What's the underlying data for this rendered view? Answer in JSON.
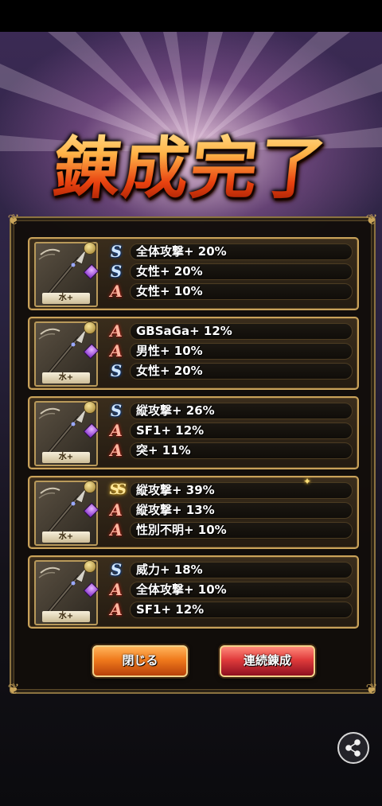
{
  "title": "錬成完了",
  "cards": [
    {
      "element": "水+",
      "skills": [
        {
          "icon": "S",
          "kind": "s",
          "text": "全体攻撃+ 20%"
        },
        {
          "icon": "S",
          "kind": "s",
          "text": "女性+ 20%"
        },
        {
          "icon": "A",
          "kind": "a",
          "text": "女性+ 10%"
        }
      ]
    },
    {
      "element": "水+",
      "skills": [
        {
          "icon": "A",
          "kind": "a",
          "text": "GBSaGa+ 12%"
        },
        {
          "icon": "A",
          "kind": "a",
          "text": "男性+ 10%"
        },
        {
          "icon": "S",
          "kind": "s",
          "text": "女性+ 20%"
        }
      ]
    },
    {
      "element": "水+",
      "skills": [
        {
          "icon": "S",
          "kind": "s",
          "text": "縦攻撃+ 26%"
        },
        {
          "icon": "A",
          "kind": "a",
          "text": "SF1+ 12%"
        },
        {
          "icon": "A",
          "kind": "a",
          "text": "突+ 11%"
        }
      ]
    },
    {
      "element": "水+",
      "skills": [
        {
          "icon": "SS",
          "kind": "ss",
          "text": "縦攻撃+ 39%"
        },
        {
          "icon": "A",
          "kind": "a",
          "text": "縦攻撃+ 13%"
        },
        {
          "icon": "A",
          "kind": "a",
          "text": "性別不明+ 10%"
        }
      ]
    },
    {
      "element": "水+",
      "skills": [
        {
          "icon": "S",
          "kind": "s",
          "text": "威力+ 18%"
        },
        {
          "icon": "A",
          "kind": "a",
          "text": "全体攻撃+ 10%"
        },
        {
          "icon": "A",
          "kind": "a",
          "text": "SF1+ 12%"
        }
      ]
    }
  ],
  "buttons": {
    "close": "閉じる",
    "again": "連続錬成"
  },
  "share_icon": "share-icon",
  "colors": {
    "gold_border": "#c9a25a",
    "close_button": "#f07a1c",
    "again_button": "#e03b3b"
  }
}
